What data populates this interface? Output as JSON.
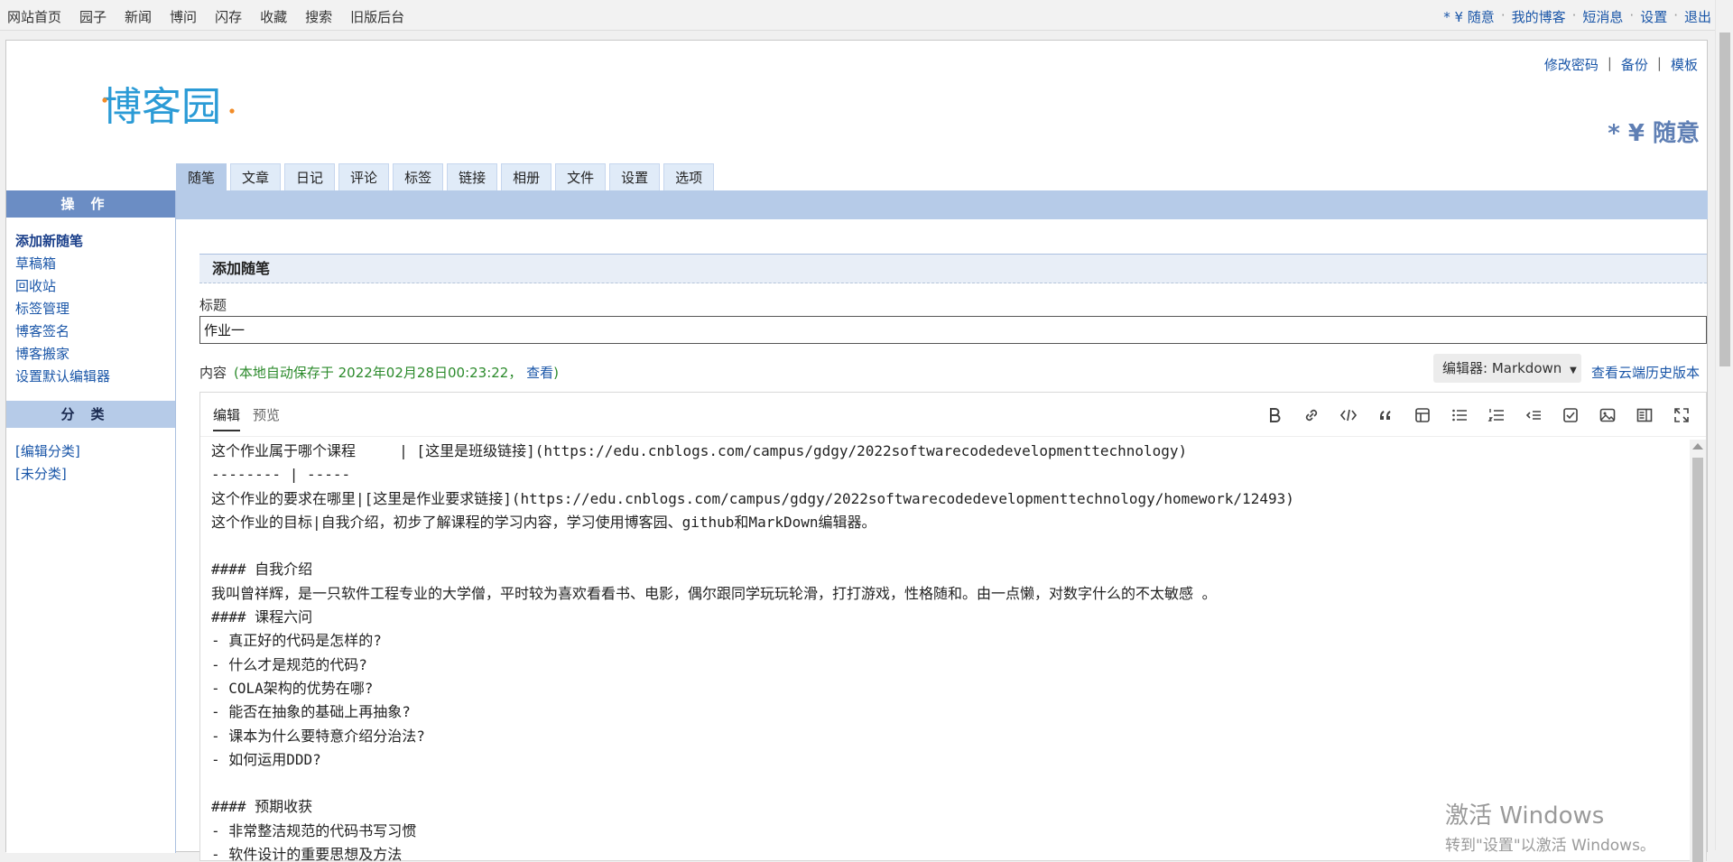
{
  "topnav": {
    "left": [
      "网站首页",
      "园子",
      "新闻",
      "博问",
      "闪存",
      "收藏",
      "搜索",
      "旧版后台"
    ],
    "right": [
      "* ¥ 随意",
      "我的博客",
      "短消息",
      "设置",
      "退出"
    ],
    "sep": "·"
  },
  "logo_text": "博客园",
  "header_links": [
    "修改密码",
    "备份",
    "模板"
  ],
  "header_sep": "|",
  "blog_title": "* ¥ 随意",
  "tabs": [
    "随笔",
    "文章",
    "日记",
    "评论",
    "标签",
    "链接",
    "相册",
    "文件",
    "设置",
    "选项"
  ],
  "sidebar": {
    "ops_title": "操作",
    "ops": [
      "添加新随笔",
      "草稿箱",
      "回收站",
      "标签管理",
      "博客签名",
      "博客搬家",
      "设置默认编辑器"
    ],
    "cat_title": "分类",
    "cats": [
      "[编辑分类]",
      "[未分类]"
    ]
  },
  "form": {
    "section_title": "添加随笔",
    "title_label": "标题",
    "title_value": "作业一",
    "content_label": "内容",
    "autosave_open": "(本地自动保存于 2022年02月28日00:23:22，",
    "autosave_link": "查看",
    "autosave_close": ")",
    "editor_select": "编辑器: Markdown",
    "history_link": "查看云端历史版本"
  },
  "editor": {
    "tabs": [
      "编辑",
      "预览"
    ],
    "toolbar": [
      "bold-icon",
      "link-icon",
      "code-icon",
      "quote-icon",
      "table-icon",
      "bullet-list-icon",
      "numbered-list-icon",
      "indent-icon",
      "checkbox-icon",
      "image-icon",
      "side-by-side-icon",
      "fullscreen-icon"
    ],
    "lines": [
      "这个作业属于哪个课程     | [这里是班级链接](https://edu.cnblogs.com/campus/gdgy/2022softwarecodedevelopmenttechnology)",
      "-------- | -----",
      "这个作业的要求在哪里|[这里是作业要求链接](https://edu.cnblogs.com/campus/gdgy/2022softwarecodedevelopmenttechnology/homework/12493)",
      "这个作业的目标|自我介绍，初步了解课程的学习内容，学习使用博客园、github和MarkDown编辑器。",
      "",
      "#### 自我介绍",
      "我叫曾祥辉，是一只软件工程专业的大学僧，平时较为喜欢看看书、电影，偶尔跟同学玩玩轮滑，打打游戏，性格随和。由一点懒，对数字什么的不太敏感 。",
      "#### 课程六问",
      "- 真正好的代码是怎样的?",
      "- 什么才是规范的代码?",
      "- COLA架构的优势在哪?",
      "- 能否在抽象的基础上再抽象?",
      "- 课本为什么要特意介绍分治法?",
      "- 如何运用DDD?",
      "",
      "#### 预期收获",
      "- 非常整洁规范的代码书写习惯",
      "- 软件设计的重要思想及方法"
    ]
  },
  "watermark": {
    "line1": "激活 Windows",
    "line2": "转到\"设置\"以激活 Windows。"
  }
}
